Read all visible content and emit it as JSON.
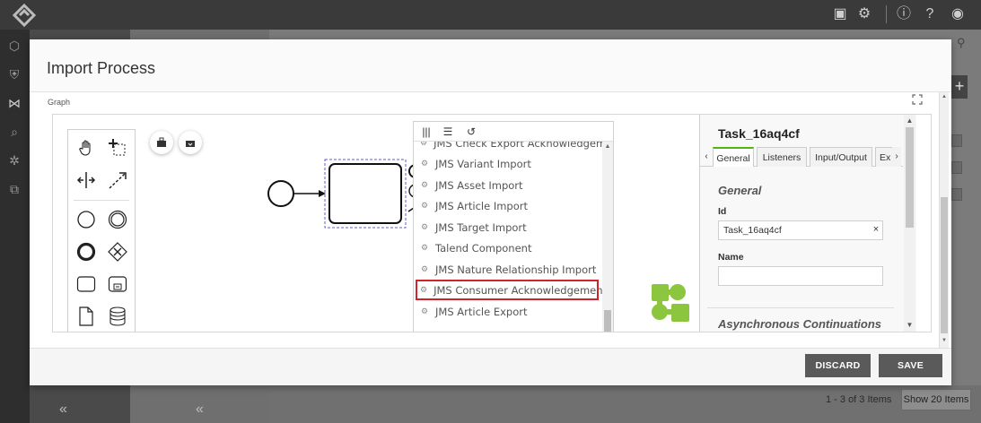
{
  "modal": {
    "title": "Import Process",
    "graph_label": "Graph",
    "discard_label": "DISCARD",
    "save_label": "SAVE"
  },
  "dropdown": {
    "items": [
      "JMS Check Export Acknowledgement",
      "JMS Variant Import",
      "JMS Asset Import",
      "JMS Article Import",
      "JMS Target Import",
      "Talend Component",
      "JMS Nature Relationship Import",
      "JMS Consumer Acknowledgement",
      "JMS Article Export"
    ],
    "highlighted": "JMS Consumer Acknowledgement"
  },
  "properties": {
    "title": "Task_16aq4cf",
    "tabs": [
      "General",
      "Listeners",
      "Input/Output",
      "Ex"
    ],
    "active_tab": "General",
    "section_general": "General",
    "id_label": "Id",
    "id_value": "Task_16aq4cf",
    "name_label": "Name",
    "name_value": "",
    "section_async": "Asynchronous Continuations"
  },
  "background": {
    "pager_text": "1 - 3 of 3 Items",
    "pager_button": "Show 20 Items"
  },
  "colors": {
    "accent_green": "#52b415",
    "highlight_red": "#d0242c",
    "button_dark": "#5a5a5a"
  },
  "icons": {
    "palette": [
      "hand-tool-icon",
      "lasso-tool-icon",
      "space-tool-icon",
      "connect-tool-icon",
      "start-event-icon",
      "intermediate-event-icon",
      "end-event-icon",
      "gateway-icon",
      "task-icon",
      "subprocess-icon",
      "data-object-icon",
      "data-store-icon"
    ],
    "toolbar": [
      "columns-icon",
      "list-icon",
      "reset-icon"
    ]
  }
}
